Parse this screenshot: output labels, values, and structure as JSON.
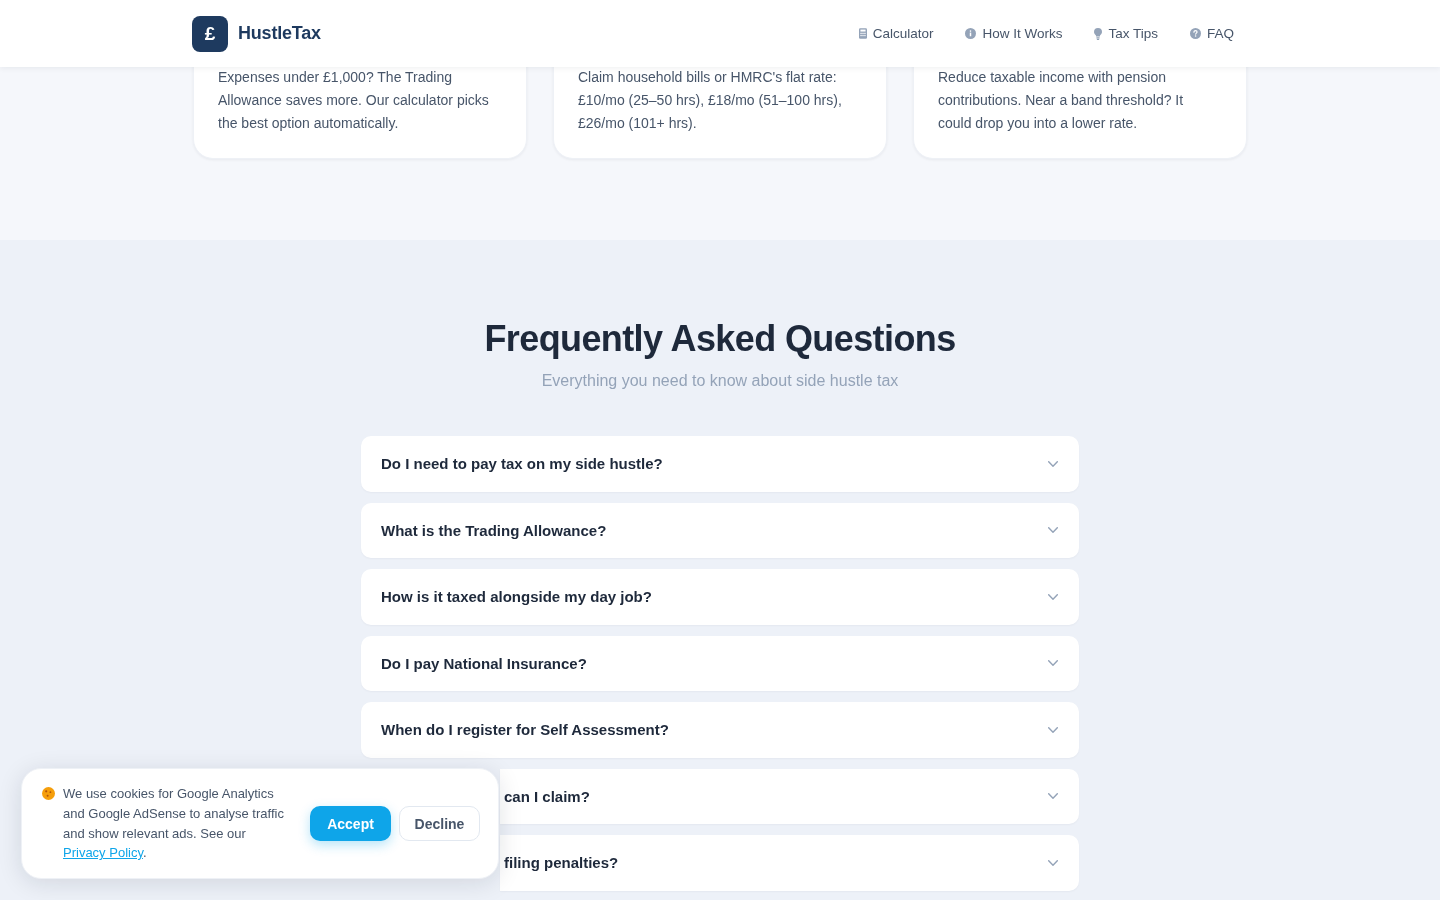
{
  "header": {
    "logo": {
      "mark": "£",
      "name": "HustleTax"
    },
    "nav": [
      {
        "label": "Calculator"
      },
      {
        "label": "How It Works"
      },
      {
        "label": "Tax Tips"
      },
      {
        "label": "FAQ"
      }
    ]
  },
  "tip_cards": [
    {
      "text": "Expenses under £1,000? The Trading Allowance saves more. Our calculator picks the best option automatically."
    },
    {
      "text": "Claim household bills or HMRC's flat rate: £10/mo (25–50 hrs), £18/mo (51–100 hrs), £26/mo (101+ hrs)."
    },
    {
      "text": "Reduce taxable income with pension contributions. Near a band threshold? It could drop you into a lower rate."
    }
  ],
  "faq": {
    "title": "Frequently Asked Questions",
    "subtitle": "Everything you need to know about side hustle tax",
    "items": [
      {
        "kind": "full",
        "question": "Do I need to pay tax on my side hustle?",
        "expanded": false
      },
      {
        "kind": "full",
        "question": "What is the Trading Allowance?",
        "expanded": false
      },
      {
        "kind": "full",
        "question": "How is it taxed alongside my day job?",
        "expanded": false
      },
      {
        "kind": "full",
        "question": "Do I pay National Insurance?",
        "expanded": false
      },
      {
        "kind": "full",
        "question": "When do I register for Self Assessment?",
        "expanded": false
      },
      {
        "kind": "covered",
        "question": "can I claim?",
        "expanded": false
      },
      {
        "kind": "covered",
        "question": "filing penalties?",
        "expanded": false
      }
    ]
  },
  "cookie_banner": {
    "text": "We use cookies for Google Analytics and Google AdSense to analyse traffic and show relevant ads. See our",
    "link": "Privacy Policy",
    "after_link": ".",
    "buttons": [
      {
        "kind": "primary",
        "label": "Accept"
      },
      {
        "kind": "secondary",
        "label": "Decline"
      }
    ]
  }
}
